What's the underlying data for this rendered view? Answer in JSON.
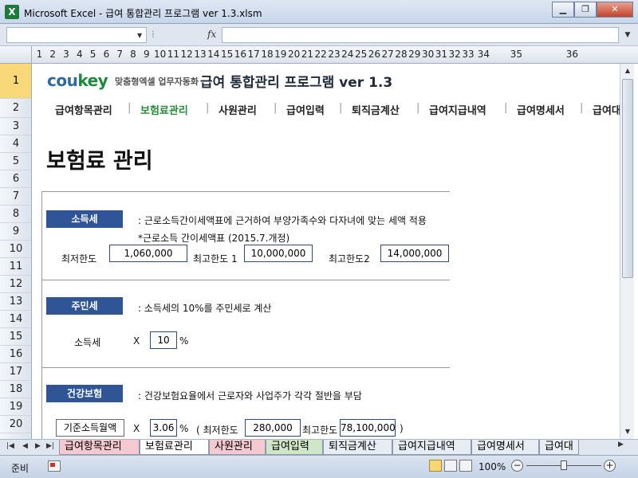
{
  "window": {
    "app_icon": "X",
    "title": "Microsoft Excel - 급여 통합관리 프로그램 ver 1.3.xlsm",
    "minimize": "▁",
    "restore": "❐",
    "close": "✕"
  },
  "formula_bar": {
    "fx": "fx",
    "formula": ""
  },
  "columns": [
    "1",
    "2",
    "3",
    "4",
    "5",
    "6",
    "7",
    "8",
    "9",
    "10",
    "11",
    "12",
    "13",
    "14",
    "15",
    "16",
    "17",
    "18",
    "19",
    "20",
    "21",
    "22",
    "23",
    "24",
    "25",
    "26",
    "27",
    "28",
    "29",
    "30",
    "31",
    "32",
    "33",
    "34",
    "35",
    "36"
  ],
  "rows": [
    "1",
    "2",
    "3",
    "4",
    "5",
    "6",
    "7",
    "8",
    "9",
    "10",
    "11",
    "12",
    "13",
    "14",
    "15",
    "16",
    "17",
    "18",
    "19",
    "20"
  ],
  "header": {
    "logo_co": "cou",
    "logo_key": "key",
    "logo_tagline": "맞춤형엑셀 업무자동화",
    "title": "급여 통합관리 프로그램 ver 1.3"
  },
  "menu": [
    {
      "label": "급여항목관리",
      "active": false
    },
    {
      "label": "보험료관리",
      "active": true
    },
    {
      "label": "사원관리",
      "active": false
    },
    {
      "label": "급여입력",
      "active": false
    },
    {
      "label": "퇴직금계산",
      "active": false
    },
    {
      "label": "급여지급내역",
      "active": false
    },
    {
      "label": "급여명세서",
      "active": false
    },
    {
      "label": "급여대",
      "active": false
    }
  ],
  "page_heading": "보험료 관리",
  "income_tax": {
    "badge": "소득세",
    "desc": ": 근로소득간이세액표에 근거하여 부양가족수와 다자녀에 맞는 세액 적용",
    "note": "*근로소득 간이세액표 (2015.7.개정)",
    "min_label": "최저한도",
    "min_value": "1,060,000",
    "max1_label": "최고한도 1",
    "max1_value": "10,000,000",
    "max2_label": "최고한도2",
    "max2_value": "14,000,000"
  },
  "resident_tax": {
    "badge": "주민세",
    "desc": ": 소득세의 10%를 주민세로 계산",
    "label": "소득세",
    "x": "X",
    "value": "10",
    "unit": "%"
  },
  "health": {
    "badge": "건강보험",
    "desc": ": 건강보험요율에서 근로자와 사업주가 각각 절반을 부담",
    "base_label": "기준소득월액",
    "x": "X",
    "rate": "3.06",
    "unit": "%",
    "min_label": "( 최저한도",
    "min_value": "280,000",
    "max_label": "최고한도",
    "max_value": "78,100,000",
    "close": ")"
  },
  "sheet_tabs": [
    {
      "label": "급여항목관리",
      "style": "pink"
    },
    {
      "label": "보험료관리",
      "style": "active"
    },
    {
      "label": "사원관리",
      "style": "pink"
    },
    {
      "label": "급여입력",
      "style": "green"
    },
    {
      "label": "퇴직금계산",
      "style": "normal"
    },
    {
      "label": "급여지급내역",
      "style": "normal"
    },
    {
      "label": "급여명세서",
      "style": "normal"
    },
    {
      "label": "급여대",
      "style": "normal"
    }
  ],
  "status": {
    "ready": "준비",
    "zoom": "100%",
    "zoom_percent": 100
  }
}
